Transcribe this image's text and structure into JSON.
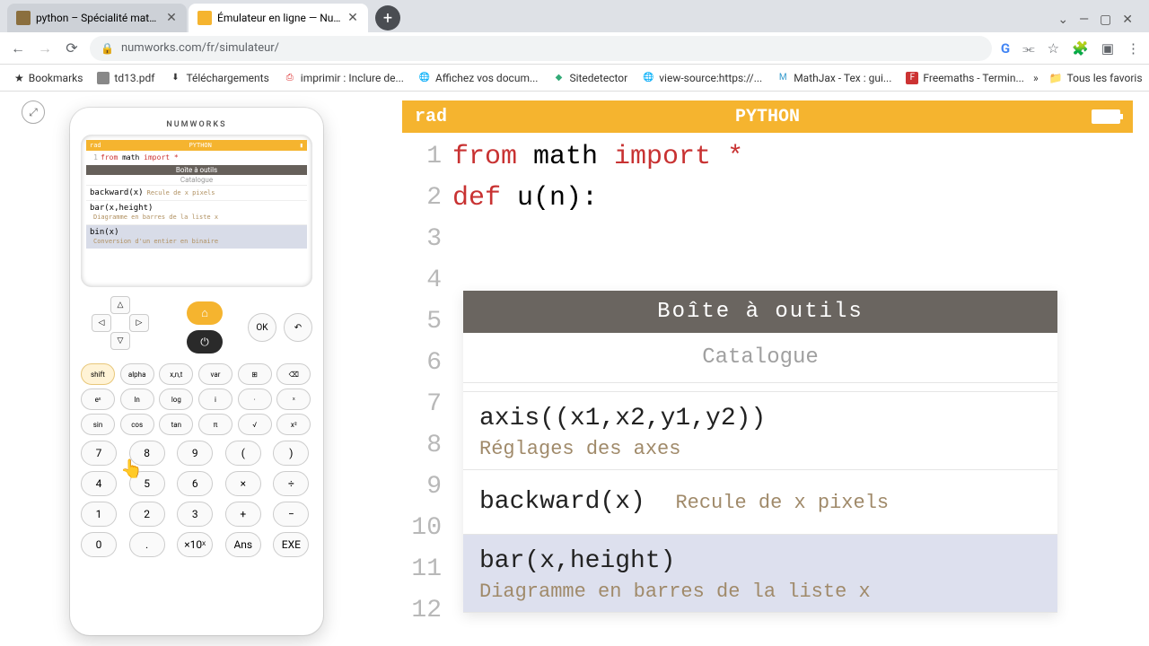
{
  "browser": {
    "tabs": [
      {
        "title": "python – Spécialité mathématic",
        "active": false
      },
      {
        "title": "Émulateur en ligne — NumWork",
        "active": true
      }
    ],
    "window": {
      "minimize": "—",
      "maximize": "▢",
      "close": "✕",
      "dropdown": "⌄"
    },
    "nav": {
      "back": "←",
      "forward": "→",
      "reload": "⟳"
    },
    "url": "numworks.com/fr/simulateur/",
    "actions": {
      "google": "G",
      "share": "share",
      "star": "☆",
      "ext": "✦",
      "panel": "▣",
      "menu": "⋮"
    },
    "bookmarks_label": "Bookmarks",
    "bookmarks": [
      {
        "label": "td13.pdf"
      },
      {
        "label": "Téléchargements"
      },
      {
        "label": "imprimir : Inclure de..."
      },
      {
        "label": "Affichez vos docum..."
      },
      {
        "label": "Sitedetector"
      },
      {
        "label": "view-source:https://..."
      },
      {
        "label": "MathJax - Tex : gui..."
      },
      {
        "label": "Freemaths - Termin..."
      }
    ],
    "bookmarks_more": "»",
    "bookmarks_folder": "Tous les favoris"
  },
  "fullscreen_btn": "⤢",
  "calculator": {
    "brand": "NUMWORKS",
    "mini": {
      "rad": "rad",
      "mode": "PYTHON",
      "line1_from": "from",
      "line1_math": " math ",
      "line1_import": "import",
      "line1_star": " *",
      "toolbox": "Boîte à outils",
      "catalogue": "Catalogue",
      "items": [
        {
          "fn": "backward(x)",
          "desc": "Recule de x pixels"
        },
        {
          "fn": "bar(x,height)",
          "desc": "Diagramme en barres de la liste x"
        },
        {
          "fn": "bin(x)",
          "desc": "Conversion d'un entier en binaire"
        }
      ]
    },
    "keys": {
      "ok": "OK",
      "back": "↶",
      "shift": "shift",
      "alpha": "alpha",
      "xnt": "x,n,t",
      "var": "var",
      "tool": "⊞",
      "del": "⌫",
      "row2": [
        "eˣ",
        "ln",
        "log",
        "i",
        "·",
        "ˣ"
      ],
      "row3": [
        "sin",
        "cos",
        "tan",
        "π",
        "√",
        "x²"
      ],
      "nums": [
        [
          "7",
          "8",
          "9",
          "(",
          ")"
        ],
        [
          "4",
          "5",
          "6",
          "×",
          "÷"
        ],
        [
          "1",
          "2",
          "3",
          "+",
          "−"
        ],
        [
          "0",
          ".",
          "×10ˣ",
          "Ans",
          "EXE"
        ]
      ]
    }
  },
  "emulator": {
    "rad": "rad",
    "mode": "PYTHON",
    "code": {
      "1": {
        "from": "from",
        "sp1": " math ",
        "import": "import",
        "sp2": " ",
        "star": "*"
      },
      "2": {
        "def": "def",
        "rest": " u(n):"
      }
    },
    "toolbox_title": "Boîte à outils",
    "catalogue": "Catalogue",
    "items": [
      {
        "fn": "axis((x1,x2,y1,y2))",
        "desc": "Réglages des axes"
      },
      {
        "fn": "backward(x)",
        "desc": "Recule de x pixels",
        "inline": true
      },
      {
        "fn": "bar(x,height)",
        "desc": "Diagramme en barres de la liste x",
        "selected": true
      }
    ]
  }
}
